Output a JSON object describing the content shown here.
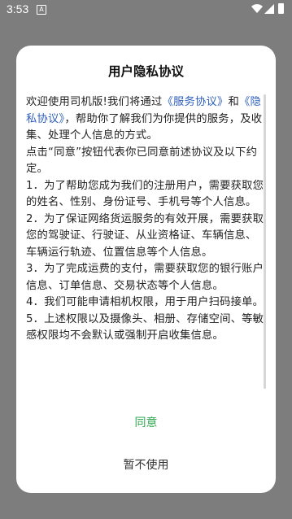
{
  "status_bar": {
    "time": "3:53",
    "notification_icon": "a-icon",
    "wifi_icon": "wifi-icon",
    "signal_icon": "signal-icon",
    "battery_icon": "battery-icon"
  },
  "dialog": {
    "title": "用户隐私协议",
    "intro": {
      "prefix": "欢迎使用司机版!我们将通过",
      "service_link": "《服务协议》",
      "and": "和",
      "privacy_link": "《隐私协议》",
      "suffix": "，帮助你了解我们为你提供的服务，及收集、处理个人信息的方式。"
    },
    "consent_note": "点击“同意”按钮代表你已同意前述协议及以下约定。",
    "items": [
      "1．为了帮助您成为我们的注册用户，需要获取您的姓名、性别、身份证号、手机号等个人信息。",
      "2．为了保证网络货运服务的有效开展，需要获取您的驾驶证、行驶证、从业资格证、车辆信息、车辆运行轨迹、位置信息等个人信息。",
      "3．为了完成运费的支付，需要获取您的银行账户信息、订单信息、交易状态等个人信息。",
      "4．我们可能申请相机权限，用于用户扫码接单。",
      "5．上述权限以及摄像头、相册、存储空间、等敏感权限均不会默认或强制开启收集信息。"
    ],
    "agree_label": "同意",
    "decline_label": "暂不使用"
  },
  "colors": {
    "accent_green": "#2fa84f",
    "link_blue": "#2f5fbd",
    "overlay": "#7d7d7d"
  }
}
